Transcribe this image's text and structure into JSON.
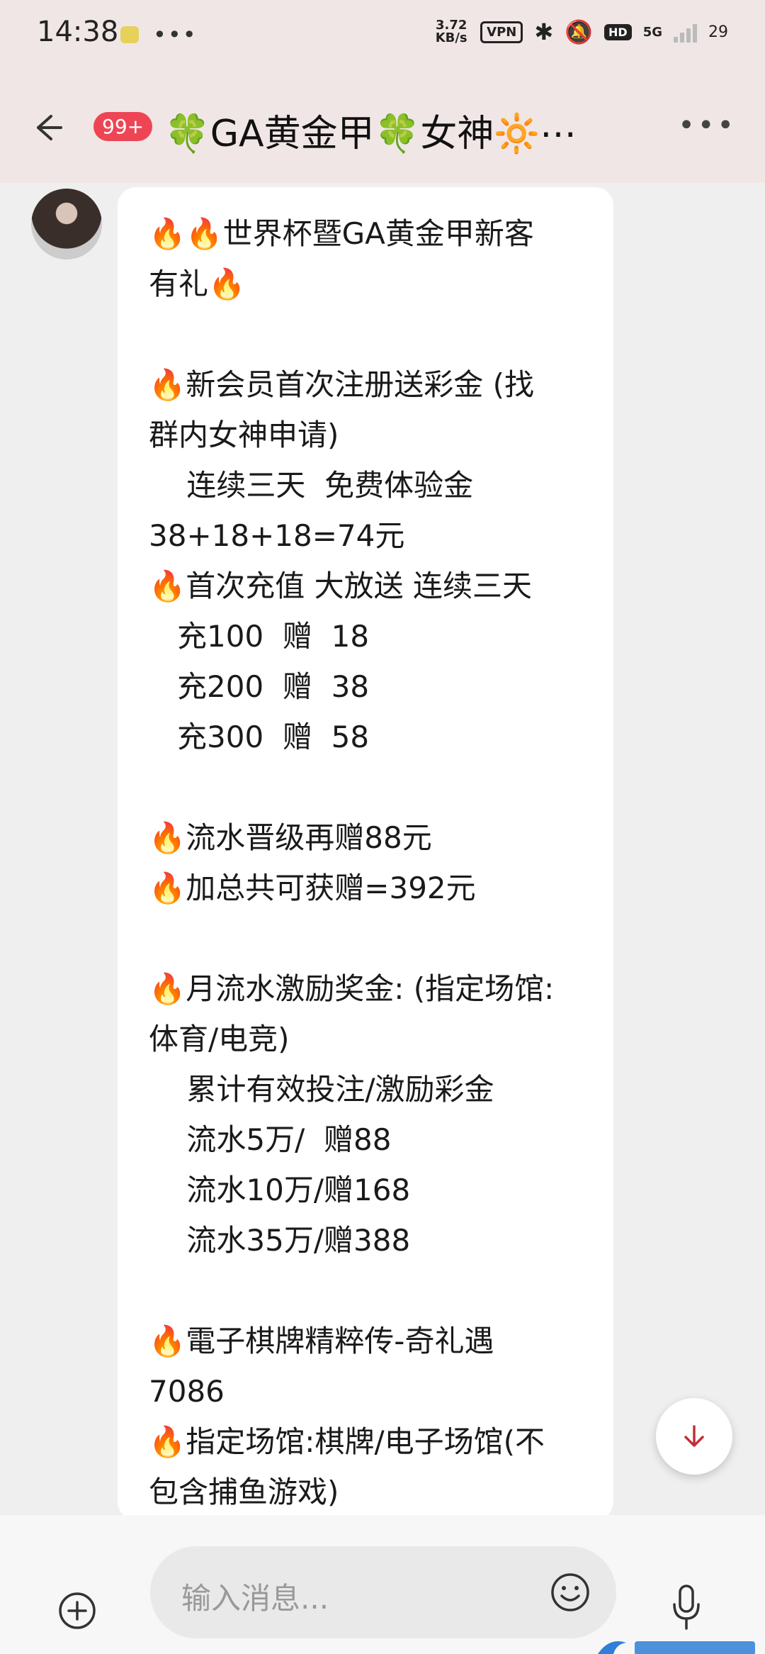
{
  "status_bar": {
    "time": "14:38",
    "network_speed": "3.72 KB/s",
    "vpn": "VPN",
    "hd": "HD",
    "network_type": "5G",
    "battery": "29"
  },
  "header": {
    "unread_badge": "99+",
    "title": "🍀GA黄金甲🍀女神🔆⋯"
  },
  "message": {
    "lines": [
      "🔥🔥世界杯暨GA黄金甲新客",
      "有礼🔥",
      "",
      "🔥新会员首次注册送彩金 (找",
      "群内女神申请)",
      "    连续三天  免费体验金",
      "38+18+18=74元",
      "🔥首次充值 大放送 连续三天",
      "   充100  赠  18",
      "   充200  赠  38",
      "   充300  赠  58",
      "",
      "🔥流水晋级再赠88元",
      "🔥加总共可获赠=392元",
      "",
      "🔥月流水激励奖金: (指定场馆:",
      "体育/电竞)",
      "    累计有效投注/激励彩金",
      "    流水5万/  赠88",
      "    流水10万/赠168",
      "    流水35万/赠388",
      "",
      "🔥電子棋牌精粹传-奇礼遇",
      "7086",
      "🔥指定场馆:棋牌/电子场馆(不",
      "包含捕鱼游戏)"
    ]
  },
  "input": {
    "placeholder": "输入消息..."
  },
  "colors": {
    "header_bg": "#f1e6e6",
    "badge": "#ee4555",
    "scroll_arrow": "#c0303a"
  }
}
